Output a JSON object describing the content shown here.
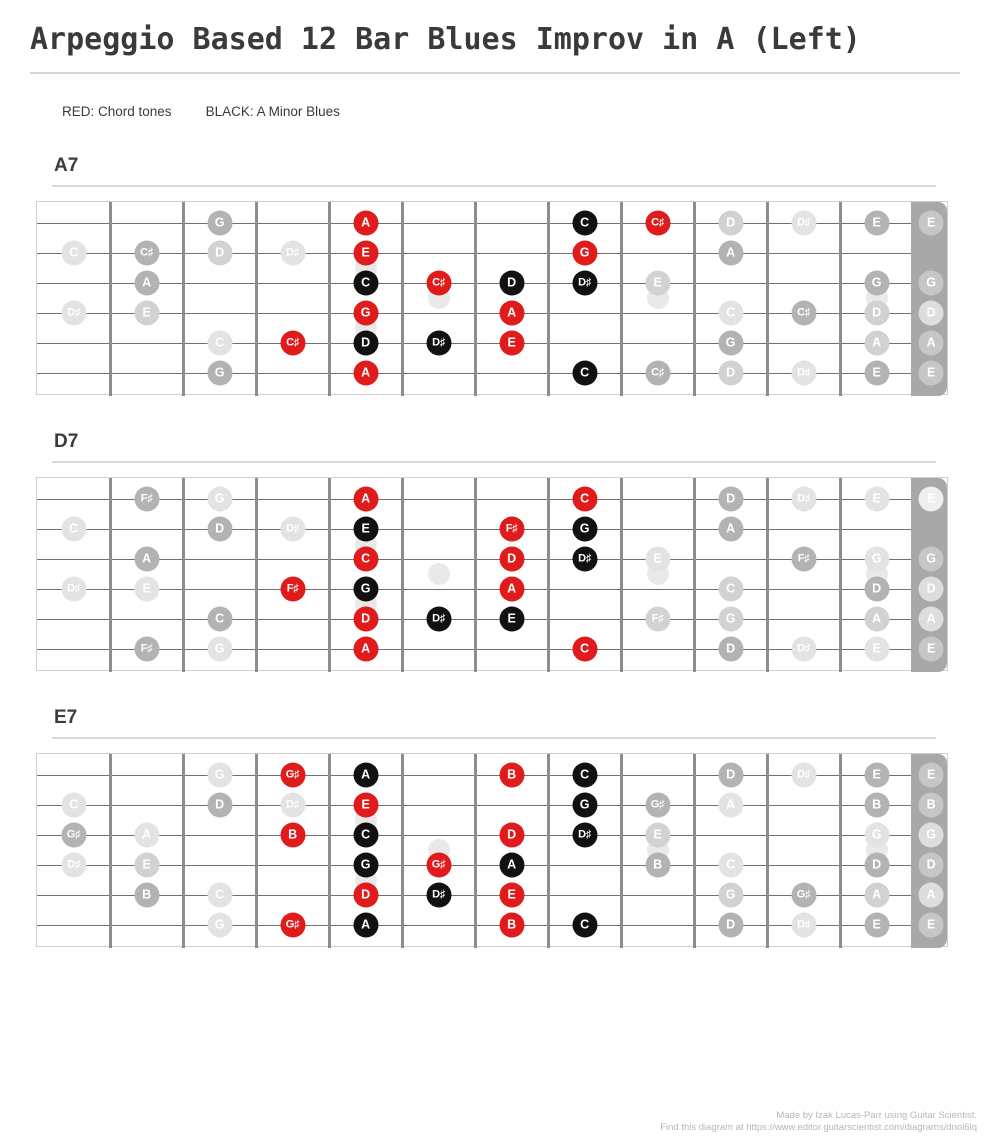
{
  "title": "Arpeggio Based 12 Bar Blues Improv in A (Left)",
  "legend": {
    "red": "RED: Chord tones",
    "black": "BLACK: A Minor Blues"
  },
  "colors": {
    "red": "#e01b1b",
    "black": "#111111",
    "grey": "#b3b3b3",
    "nut": "#a8a8a8",
    "fret": "#8d8d8d",
    "string": "#6f6f6f"
  },
  "footer": {
    "line1": "Made by Izak Lucas-Parr using Guitar Scientist.",
    "line2": "Find this diagram at https://www.editor.guitarscientist.com/diagrams/dnol6lq"
  },
  "layout": {
    "orientation": "left-handed",
    "fret_count": 12,
    "string_count": 6,
    "inlay_columns": [
      1,
      4,
      7,
      8
    ],
    "inlay_double_column": 8
  },
  "chart_data": {
    "type": "fretboard-diagram",
    "title": "Arpeggio Based 12 Bar Blues Improv in A (Left)",
    "orientation": "left-handed",
    "strings_high_to_low": [
      "E",
      "B",
      "G",
      "D",
      "A",
      "E"
    ],
    "boards": [
      {
        "name": "A7",
        "open_strings": [
          {
            "string": 1,
            "label": "E",
            "tone": "open"
          },
          {
            "string": 3,
            "label": "G",
            "tone": "open"
          },
          {
            "string": 4,
            "label": "D",
            "tone": "openl"
          },
          {
            "string": 5,
            "label": "A",
            "tone": "open"
          },
          {
            "string": 6,
            "label": "E",
            "tone": "open"
          }
        ],
        "notes": [
          {
            "col": 1,
            "string": 1,
            "label": "E",
            "tone": "grey"
          },
          {
            "col": 1,
            "string": 3,
            "label": "G",
            "tone": "grey"
          },
          {
            "col": 1,
            "string": 4,
            "label": "D",
            "tone": "greyl"
          },
          {
            "col": 1,
            "string": 5,
            "label": "A",
            "tone": "greyl"
          },
          {
            "col": 1,
            "string": 6,
            "label": "E",
            "tone": "grey"
          },
          {
            "col": 2,
            "string": 1,
            "label": "D♯",
            "tone": "greyx"
          },
          {
            "col": 2,
            "string": 4,
            "label": "C♯",
            "tone": "grey"
          },
          {
            "col": 2,
            "string": 6,
            "label": "D♯",
            "tone": "greyx"
          },
          {
            "col": 3,
            "string": 1,
            "label": "D",
            "tone": "greyl"
          },
          {
            "col": 3,
            "string": 2,
            "label": "A",
            "tone": "grey"
          },
          {
            "col": 3,
            "string": 4,
            "label": "C",
            "tone": "greyx"
          },
          {
            "col": 3,
            "string": 5,
            "label": "G",
            "tone": "grey"
          },
          {
            "col": 3,
            "string": 6,
            "label": "D",
            "tone": "greyl"
          },
          {
            "col": 4,
            "string": 1,
            "label": "C♯",
            "tone": "red"
          },
          {
            "col": 4,
            "string": 3,
            "label": "E",
            "tone": "greyl"
          },
          {
            "col": 4,
            "string": 6,
            "label": "C♯",
            "tone": "grey"
          },
          {
            "col": 5,
            "string": 1,
            "label": "C",
            "tone": "black"
          },
          {
            "col": 5,
            "string": 2,
            "label": "G",
            "tone": "red"
          },
          {
            "col": 5,
            "string": 3,
            "label": "D♯",
            "tone": "black"
          },
          {
            "col": 5,
            "string": 6,
            "label": "C",
            "tone": "black"
          },
          {
            "col": 6,
            "string": 3,
            "label": "D",
            "tone": "black"
          },
          {
            "col": 6,
            "string": 4,
            "label": "A",
            "tone": "red"
          },
          {
            "col": 6,
            "string": 5,
            "label": "E",
            "tone": "red"
          },
          {
            "col": 7,
            "string": 3,
            "label": "C♯",
            "tone": "red"
          },
          {
            "col": 7,
            "string": 5,
            "label": "D♯",
            "tone": "black"
          },
          {
            "col": 8,
            "string": 1,
            "label": "A",
            "tone": "red"
          },
          {
            "col": 8,
            "string": 2,
            "label": "E",
            "tone": "red"
          },
          {
            "col": 8,
            "string": 3,
            "label": "C",
            "tone": "black"
          },
          {
            "col": 8,
            "string": 4,
            "label": "G",
            "tone": "red"
          },
          {
            "col": 8,
            "string": 5,
            "label": "D",
            "tone": "black"
          },
          {
            "col": 8,
            "string": 6,
            "label": "A",
            "tone": "red"
          },
          {
            "col": 9,
            "string": 2,
            "label": "D♯",
            "tone": "greyx"
          },
          {
            "col": 9,
            "string": 5,
            "label": "C♯",
            "tone": "red"
          },
          {
            "col": 10,
            "string": 1,
            "label": "G",
            "tone": "grey"
          },
          {
            "col": 10,
            "string": 2,
            "label": "D",
            "tone": "greyl"
          },
          {
            "col": 10,
            "string": 5,
            "label": "C",
            "tone": "greyx"
          },
          {
            "col": 10,
            "string": 6,
            "label": "G",
            "tone": "grey"
          },
          {
            "col": 11,
            "string": 2,
            "label": "C♯",
            "tone": "grey"
          },
          {
            "col": 11,
            "string": 3,
            "label": "A",
            "tone": "grey"
          },
          {
            "col": 11,
            "string": 4,
            "label": "E",
            "tone": "greyl"
          },
          {
            "col": 12,
            "string": 2,
            "label": "C",
            "tone": "greyx"
          },
          {
            "col": 12,
            "string": 4,
            "label": "D♯",
            "tone": "greyx"
          }
        ]
      },
      {
        "name": "D7",
        "open_strings": [
          {
            "string": 1,
            "label": "E",
            "tone": "openx"
          },
          {
            "string": 3,
            "label": "G",
            "tone": "open"
          },
          {
            "string": 4,
            "label": "D",
            "tone": "openl"
          },
          {
            "string": 5,
            "label": "A",
            "tone": "openl"
          },
          {
            "string": 6,
            "label": "E",
            "tone": "open"
          }
        ],
        "notes": [
          {
            "col": 1,
            "string": 1,
            "label": "E",
            "tone": "greyx"
          },
          {
            "col": 1,
            "string": 3,
            "label": "G",
            "tone": "greyx"
          },
          {
            "col": 1,
            "string": 4,
            "label": "D",
            "tone": "grey"
          },
          {
            "col": 1,
            "string": 5,
            "label": "A",
            "tone": "greyl"
          },
          {
            "col": 1,
            "string": 6,
            "label": "E",
            "tone": "greyx"
          },
          {
            "col": 2,
            "string": 1,
            "label": "D♯",
            "tone": "greyx"
          },
          {
            "col": 2,
            "string": 3,
            "label": "F♯",
            "tone": "grey"
          },
          {
            "col": 2,
            "string": 6,
            "label": "D♯",
            "tone": "greyx"
          },
          {
            "col": 3,
            "string": 1,
            "label": "D",
            "tone": "grey"
          },
          {
            "col": 3,
            "string": 2,
            "label": "A",
            "tone": "grey"
          },
          {
            "col": 3,
            "string": 4,
            "label": "C",
            "tone": "greyl"
          },
          {
            "col": 3,
            "string": 5,
            "label": "G",
            "tone": "greyl"
          },
          {
            "col": 3,
            "string": 6,
            "label": "D",
            "tone": "grey"
          },
          {
            "col": 4,
            "string": 3,
            "label": "E",
            "tone": "greyx"
          },
          {
            "col": 4,
            "string": 5,
            "label": "F♯",
            "tone": "greyl"
          },
          {
            "col": 5,
            "string": 1,
            "label": "C",
            "tone": "red"
          },
          {
            "col": 5,
            "string": 2,
            "label": "G",
            "tone": "black"
          },
          {
            "col": 5,
            "string": 3,
            "label": "D♯",
            "tone": "black"
          },
          {
            "col": 5,
            "string": 6,
            "label": "C",
            "tone": "red"
          },
          {
            "col": 6,
            "string": 2,
            "label": "F♯",
            "tone": "red"
          },
          {
            "col": 6,
            "string": 3,
            "label": "D",
            "tone": "red"
          },
          {
            "col": 6,
            "string": 4,
            "label": "A",
            "tone": "red"
          },
          {
            "col": 6,
            "string": 5,
            "label": "E",
            "tone": "black"
          },
          {
            "col": 7,
            "string": 5,
            "label": "D♯",
            "tone": "black"
          },
          {
            "col": 8,
            "string": 1,
            "label": "A",
            "tone": "red"
          },
          {
            "col": 8,
            "string": 2,
            "label": "E",
            "tone": "black"
          },
          {
            "col": 8,
            "string": 3,
            "label": "C",
            "tone": "red"
          },
          {
            "col": 8,
            "string": 4,
            "label": "G",
            "tone": "black"
          },
          {
            "col": 8,
            "string": 5,
            "label": "D",
            "tone": "red"
          },
          {
            "col": 8,
            "string": 6,
            "label": "A",
            "tone": "red"
          },
          {
            "col": 9,
            "string": 2,
            "label": "D♯",
            "tone": "greyx"
          },
          {
            "col": 9,
            "string": 4,
            "label": "F♯",
            "tone": "red"
          },
          {
            "col": 10,
            "string": 1,
            "label": "G",
            "tone": "greyx"
          },
          {
            "col": 10,
            "string": 2,
            "label": "D",
            "tone": "grey"
          },
          {
            "col": 10,
            "string": 5,
            "label": "C",
            "tone": "grey"
          },
          {
            "col": 10,
            "string": 6,
            "label": "G",
            "tone": "greyx"
          },
          {
            "col": 11,
            "string": 1,
            "label": "F♯",
            "tone": "grey"
          },
          {
            "col": 11,
            "string": 3,
            "label": "A",
            "tone": "grey"
          },
          {
            "col": 11,
            "string": 4,
            "label": "E",
            "tone": "greyx"
          },
          {
            "col": 11,
            "string": 6,
            "label": "F♯",
            "tone": "grey"
          },
          {
            "col": 12,
            "string": 2,
            "label": "C",
            "tone": "greyx"
          },
          {
            "col": 12,
            "string": 4,
            "label": "D♯",
            "tone": "greyx"
          }
        ]
      },
      {
        "name": "E7",
        "open_strings": [
          {
            "string": 1,
            "label": "E",
            "tone": "open"
          },
          {
            "string": 2,
            "label": "B",
            "tone": "open"
          },
          {
            "string": 3,
            "label": "G",
            "tone": "openl"
          },
          {
            "string": 4,
            "label": "D",
            "tone": "open"
          },
          {
            "string": 5,
            "label": "A",
            "tone": "openl"
          },
          {
            "string": 6,
            "label": "E",
            "tone": "open"
          }
        ],
        "notes": [
          {
            "col": 1,
            "string": 1,
            "label": "E",
            "tone": "grey"
          },
          {
            "col": 1,
            "string": 2,
            "label": "B",
            "tone": "grey"
          },
          {
            "col": 1,
            "string": 3,
            "label": "G",
            "tone": "greyx"
          },
          {
            "col": 1,
            "string": 4,
            "label": "D",
            "tone": "grey"
          },
          {
            "col": 1,
            "string": 5,
            "label": "A",
            "tone": "greyl"
          },
          {
            "col": 1,
            "string": 6,
            "label": "E",
            "tone": "grey"
          },
          {
            "col": 2,
            "string": 1,
            "label": "D♯",
            "tone": "greyx"
          },
          {
            "col": 2,
            "string": 5,
            "label": "G♯",
            "tone": "grey"
          },
          {
            "col": 2,
            "string": 6,
            "label": "D♯",
            "tone": "greyx"
          },
          {
            "col": 3,
            "string": 1,
            "label": "D",
            "tone": "grey"
          },
          {
            "col": 3,
            "string": 2,
            "label": "A",
            "tone": "greyx"
          },
          {
            "col": 3,
            "string": 4,
            "label": "C",
            "tone": "greyx"
          },
          {
            "col": 3,
            "string": 5,
            "label": "G",
            "tone": "greyl"
          },
          {
            "col": 3,
            "string": 6,
            "label": "D",
            "tone": "grey"
          },
          {
            "col": 4,
            "string": 2,
            "label": "G♯",
            "tone": "grey"
          },
          {
            "col": 4,
            "string": 3,
            "label": "E",
            "tone": "greyl"
          },
          {
            "col": 4,
            "string": 4,
            "label": "B",
            "tone": "grey"
          },
          {
            "col": 5,
            "string": 1,
            "label": "C",
            "tone": "black"
          },
          {
            "col": 5,
            "string": 2,
            "label": "G",
            "tone": "black"
          },
          {
            "col": 5,
            "string": 3,
            "label": "D♯",
            "tone": "black"
          },
          {
            "col": 5,
            "string": 6,
            "label": "C",
            "tone": "black"
          },
          {
            "col": 6,
            "string": 1,
            "label": "B",
            "tone": "red"
          },
          {
            "col": 6,
            "string": 3,
            "label": "D",
            "tone": "red"
          },
          {
            "col": 6,
            "string": 4,
            "label": "A",
            "tone": "black"
          },
          {
            "col": 6,
            "string": 5,
            "label": "E",
            "tone": "red"
          },
          {
            "col": 6,
            "string": 6,
            "label": "B",
            "tone": "red"
          },
          {
            "col": 7,
            "string": 4,
            "label": "G♯",
            "tone": "red"
          },
          {
            "col": 7,
            "string": 5,
            "label": "D♯",
            "tone": "black"
          },
          {
            "col": 8,
            "string": 1,
            "label": "A",
            "tone": "black"
          },
          {
            "col": 8,
            "string": 2,
            "label": "E",
            "tone": "red"
          },
          {
            "col": 8,
            "string": 3,
            "label": "C",
            "tone": "black"
          },
          {
            "col": 8,
            "string": 4,
            "label": "G",
            "tone": "black"
          },
          {
            "col": 8,
            "string": 5,
            "label": "D",
            "tone": "red"
          },
          {
            "col": 8,
            "string": 6,
            "label": "A",
            "tone": "black"
          },
          {
            "col": 9,
            "string": 1,
            "label": "G♯",
            "tone": "red"
          },
          {
            "col": 9,
            "string": 2,
            "label": "D♯",
            "tone": "greyx"
          },
          {
            "col": 9,
            "string": 3,
            "label": "B",
            "tone": "red"
          },
          {
            "col": 9,
            "string": 6,
            "label": "G♯",
            "tone": "red"
          },
          {
            "col": 10,
            "string": 1,
            "label": "G",
            "tone": "greyx"
          },
          {
            "col": 10,
            "string": 2,
            "label": "D",
            "tone": "grey"
          },
          {
            "col": 10,
            "string": 5,
            "label": "C",
            "tone": "greyx"
          },
          {
            "col": 10,
            "string": 6,
            "label": "G",
            "tone": "greyx"
          },
          {
            "col": 11,
            "string": 3,
            "label": "A",
            "tone": "greyx"
          },
          {
            "col": 11,
            "string": 4,
            "label": "E",
            "tone": "greyl"
          },
          {
            "col": 11,
            "string": 5,
            "label": "B",
            "tone": "grey"
          },
          {
            "col": 12,
            "string": 2,
            "label": "C",
            "tone": "greyx"
          },
          {
            "col": 12,
            "string": 3,
            "label": "G♯",
            "tone": "grey"
          },
          {
            "col": 12,
            "string": 4,
            "label": "D♯",
            "tone": "greyx"
          }
        ]
      }
    ]
  }
}
